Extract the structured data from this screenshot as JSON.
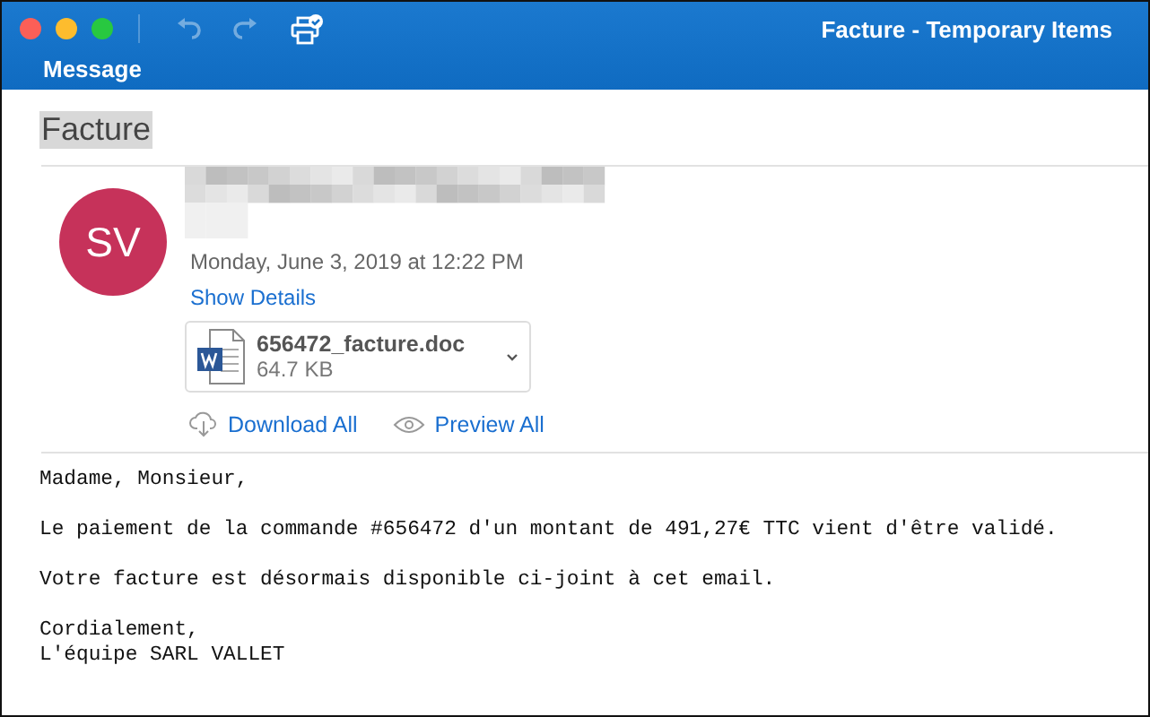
{
  "window": {
    "title": "Facture - Temporary Items"
  },
  "toolbar": [
    {
      "kind": "undo",
      "disabled": true
    },
    {
      "kind": "redo",
      "disabled": true
    },
    {
      "kind": "print",
      "disabled": false
    }
  ],
  "ribbon_tab": {
    "label": "Message"
  },
  "message": {
    "subject": "Facture",
    "avatar": {
      "initials": "SV",
      "color": "#c6325a"
    },
    "date": "Monday, June 3, 2019 at 12:22 PM",
    "show_details": "Show Details",
    "attachment": {
      "name": "656472_facture.doc",
      "size": "64.7 KB"
    },
    "actions": [
      {
        "kind": "download",
        "label": "Download All"
      },
      {
        "kind": "preview",
        "label": "Preview All"
      }
    ],
    "body": [
      [
        "Madame, Monsieur,"
      ],
      [
        "Le paiement de la commande #656472 d'un montant de 491,27€ TTC vient d'être validé."
      ],
      [
        "Votre facture est désormais disponible ci-joint à cet email."
      ],
      [
        "Cordialement,",
        "L'équipe SARL VALLET"
      ]
    ]
  }
}
